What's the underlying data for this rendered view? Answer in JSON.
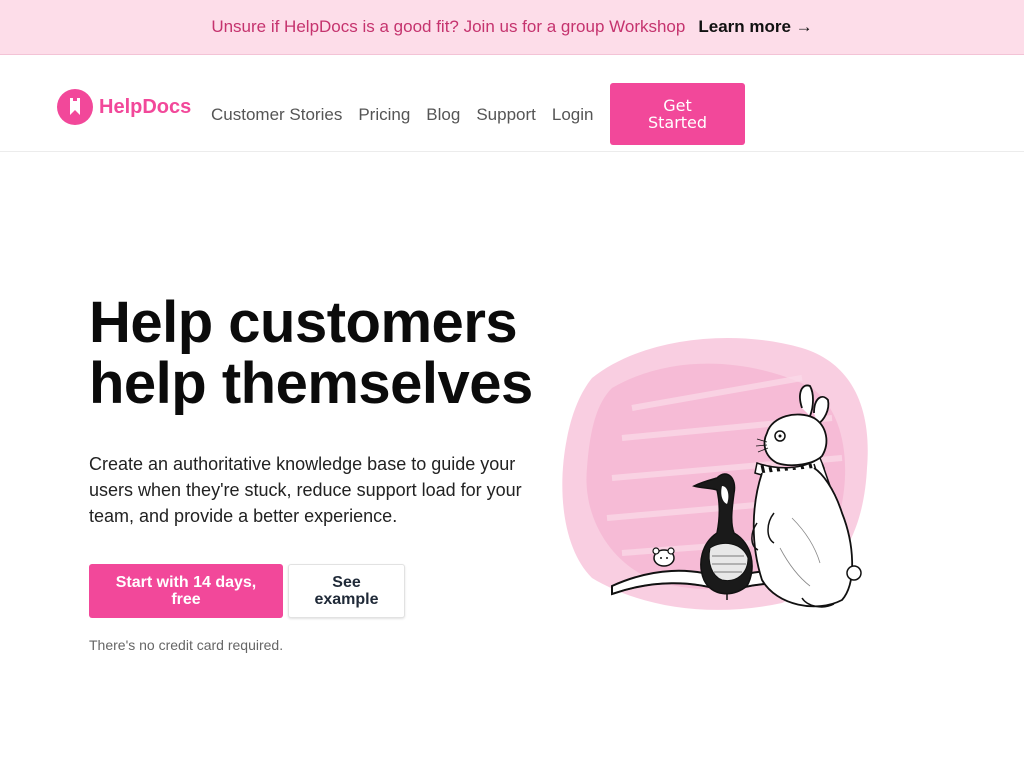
{
  "banner": {
    "text": "Unsure if HelpDocs is a good fit? Join us for a group Workshop",
    "link": "Learn more →"
  },
  "header": {
    "logo_text": "HelpDocs",
    "nav": [
      "Customer Stories",
      "Pricing",
      "Blog",
      "Support",
      "Login"
    ],
    "cta": "Get Started"
  },
  "hero": {
    "title_line1": "Help customers",
    "title_line2": "help themselves",
    "description": "Create an authoritative knowledge base to guide your users when they're stuck, reduce support load for your team, and provide a better experience.",
    "primary_button": "Start with 14 days, free",
    "secondary_button": "See example",
    "note": "There's no credit card required."
  },
  "colors": {
    "brand": "#f2489a",
    "banner_bg": "#fddde9",
    "banner_text": "#c5336e"
  },
  "icons": {
    "logo": "helpdocs-bookmark-logo-icon",
    "illustration": "rabbit-goose-mouse-reading-book-illustration"
  }
}
